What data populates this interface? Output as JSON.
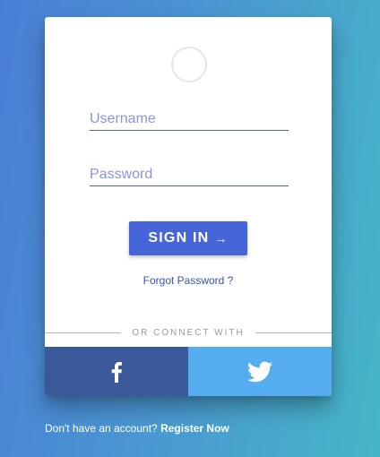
{
  "login": {
    "username_placeholder": "Username",
    "password_placeholder": "Password",
    "signin_label": "SIGN IN",
    "signin_arrow": "→",
    "forgot_label": "Forgot Password ?",
    "divider_label": "OR CONNECT WITH"
  },
  "social": {
    "facebook_icon": "facebook-icon",
    "twitter_icon": "twitter-icon",
    "facebook_color": "#3b5998",
    "twitter_color": "#55acee"
  },
  "footer": {
    "prompt": "Don't have an account?",
    "register_label": "Register Now"
  },
  "colors": {
    "accent": "#4565d8",
    "link": "#3552b8",
    "background_start": "#4a7fd6",
    "background_end": "#46b6c6"
  }
}
